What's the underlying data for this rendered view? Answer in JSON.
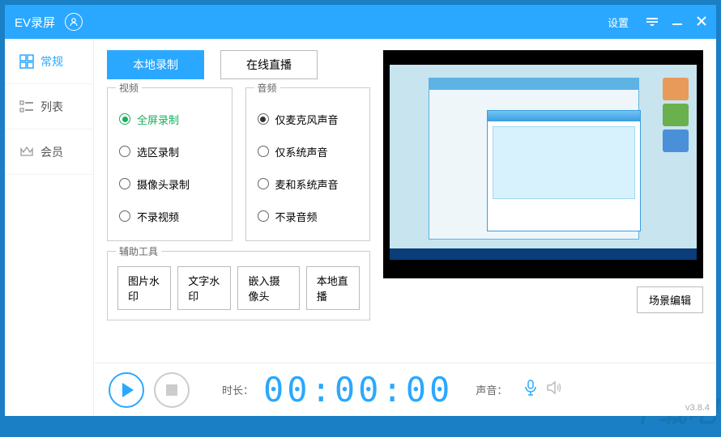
{
  "app": {
    "title": "EV录屏",
    "settings_label": "设置",
    "version": "v3.8.4"
  },
  "sidebar": {
    "items": [
      {
        "label": "常规",
        "active": true
      },
      {
        "label": "列表",
        "active": false
      },
      {
        "label": "会员",
        "active": false
      }
    ]
  },
  "tabs": {
    "local": "本地录制",
    "live": "在线直播"
  },
  "video_group": {
    "title": "视频",
    "options": [
      "全屏录制",
      "选区录制",
      "摄像头录制",
      "不录视频"
    ],
    "selected": 0
  },
  "audio_group": {
    "title": "音频",
    "options": [
      "仅麦克风声音",
      "仅系统声音",
      "麦和系统声音",
      "不录音频"
    ],
    "selected": 0
  },
  "tools_group": {
    "title": "辅助工具",
    "buttons": [
      "图片水印",
      "文字水印",
      "嵌入摄像头",
      "本地直播"
    ]
  },
  "preview": {
    "edit_button": "场景编辑"
  },
  "footer": {
    "duration_label": "时长：",
    "duration_value": "00:00:00",
    "sound_label": "声音："
  }
}
